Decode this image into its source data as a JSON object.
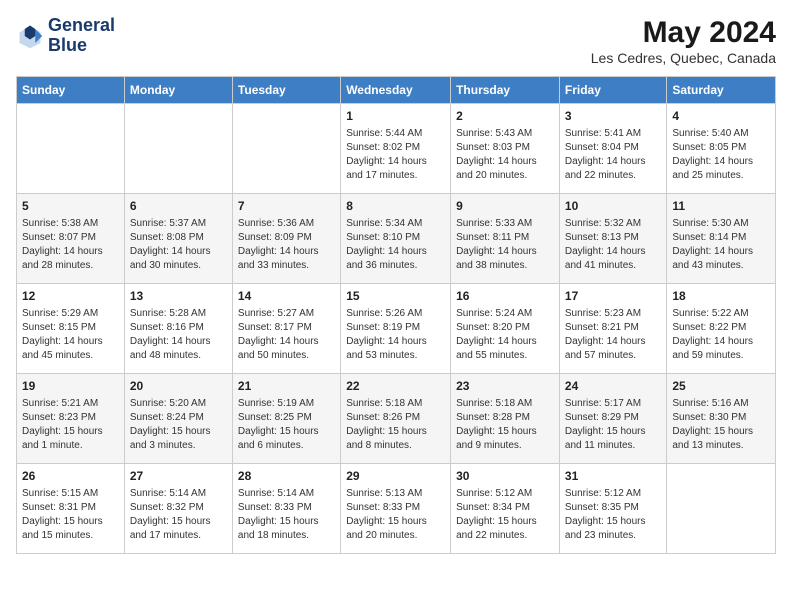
{
  "header": {
    "logo_line1": "General",
    "logo_line2": "Blue",
    "month": "May 2024",
    "location": "Les Cedres, Quebec, Canada"
  },
  "days_of_week": [
    "Sunday",
    "Monday",
    "Tuesday",
    "Wednesday",
    "Thursday",
    "Friday",
    "Saturday"
  ],
  "weeks": [
    [
      {
        "day": "",
        "info": ""
      },
      {
        "day": "",
        "info": ""
      },
      {
        "day": "",
        "info": ""
      },
      {
        "day": "1",
        "info": "Sunrise: 5:44 AM\nSunset: 8:02 PM\nDaylight: 14 hours and 17 minutes."
      },
      {
        "day": "2",
        "info": "Sunrise: 5:43 AM\nSunset: 8:03 PM\nDaylight: 14 hours and 20 minutes."
      },
      {
        "day": "3",
        "info": "Sunrise: 5:41 AM\nSunset: 8:04 PM\nDaylight: 14 hours and 22 minutes."
      },
      {
        "day": "4",
        "info": "Sunrise: 5:40 AM\nSunset: 8:05 PM\nDaylight: 14 hours and 25 minutes."
      }
    ],
    [
      {
        "day": "5",
        "info": "Sunrise: 5:38 AM\nSunset: 8:07 PM\nDaylight: 14 hours and 28 minutes."
      },
      {
        "day": "6",
        "info": "Sunrise: 5:37 AM\nSunset: 8:08 PM\nDaylight: 14 hours and 30 minutes."
      },
      {
        "day": "7",
        "info": "Sunrise: 5:36 AM\nSunset: 8:09 PM\nDaylight: 14 hours and 33 minutes."
      },
      {
        "day": "8",
        "info": "Sunrise: 5:34 AM\nSunset: 8:10 PM\nDaylight: 14 hours and 36 minutes."
      },
      {
        "day": "9",
        "info": "Sunrise: 5:33 AM\nSunset: 8:11 PM\nDaylight: 14 hours and 38 minutes."
      },
      {
        "day": "10",
        "info": "Sunrise: 5:32 AM\nSunset: 8:13 PM\nDaylight: 14 hours and 41 minutes."
      },
      {
        "day": "11",
        "info": "Sunrise: 5:30 AM\nSunset: 8:14 PM\nDaylight: 14 hours and 43 minutes."
      }
    ],
    [
      {
        "day": "12",
        "info": "Sunrise: 5:29 AM\nSunset: 8:15 PM\nDaylight: 14 hours and 45 minutes."
      },
      {
        "day": "13",
        "info": "Sunrise: 5:28 AM\nSunset: 8:16 PM\nDaylight: 14 hours and 48 minutes."
      },
      {
        "day": "14",
        "info": "Sunrise: 5:27 AM\nSunset: 8:17 PM\nDaylight: 14 hours and 50 minutes."
      },
      {
        "day": "15",
        "info": "Sunrise: 5:26 AM\nSunset: 8:19 PM\nDaylight: 14 hours and 53 minutes."
      },
      {
        "day": "16",
        "info": "Sunrise: 5:24 AM\nSunset: 8:20 PM\nDaylight: 14 hours and 55 minutes."
      },
      {
        "day": "17",
        "info": "Sunrise: 5:23 AM\nSunset: 8:21 PM\nDaylight: 14 hours and 57 minutes."
      },
      {
        "day": "18",
        "info": "Sunrise: 5:22 AM\nSunset: 8:22 PM\nDaylight: 14 hours and 59 minutes."
      }
    ],
    [
      {
        "day": "19",
        "info": "Sunrise: 5:21 AM\nSunset: 8:23 PM\nDaylight: 15 hours and 1 minute."
      },
      {
        "day": "20",
        "info": "Sunrise: 5:20 AM\nSunset: 8:24 PM\nDaylight: 15 hours and 3 minutes."
      },
      {
        "day": "21",
        "info": "Sunrise: 5:19 AM\nSunset: 8:25 PM\nDaylight: 15 hours and 6 minutes."
      },
      {
        "day": "22",
        "info": "Sunrise: 5:18 AM\nSunset: 8:26 PM\nDaylight: 15 hours and 8 minutes."
      },
      {
        "day": "23",
        "info": "Sunrise: 5:18 AM\nSunset: 8:28 PM\nDaylight: 15 hours and 9 minutes."
      },
      {
        "day": "24",
        "info": "Sunrise: 5:17 AM\nSunset: 8:29 PM\nDaylight: 15 hours and 11 minutes."
      },
      {
        "day": "25",
        "info": "Sunrise: 5:16 AM\nSunset: 8:30 PM\nDaylight: 15 hours and 13 minutes."
      }
    ],
    [
      {
        "day": "26",
        "info": "Sunrise: 5:15 AM\nSunset: 8:31 PM\nDaylight: 15 hours and 15 minutes."
      },
      {
        "day": "27",
        "info": "Sunrise: 5:14 AM\nSunset: 8:32 PM\nDaylight: 15 hours and 17 minutes."
      },
      {
        "day": "28",
        "info": "Sunrise: 5:14 AM\nSunset: 8:33 PM\nDaylight: 15 hours and 18 minutes."
      },
      {
        "day": "29",
        "info": "Sunrise: 5:13 AM\nSunset: 8:33 PM\nDaylight: 15 hours and 20 minutes."
      },
      {
        "day": "30",
        "info": "Sunrise: 5:12 AM\nSunset: 8:34 PM\nDaylight: 15 hours and 22 minutes."
      },
      {
        "day": "31",
        "info": "Sunrise: 5:12 AM\nSunset: 8:35 PM\nDaylight: 15 hours and 23 minutes."
      },
      {
        "day": "",
        "info": ""
      }
    ]
  ]
}
